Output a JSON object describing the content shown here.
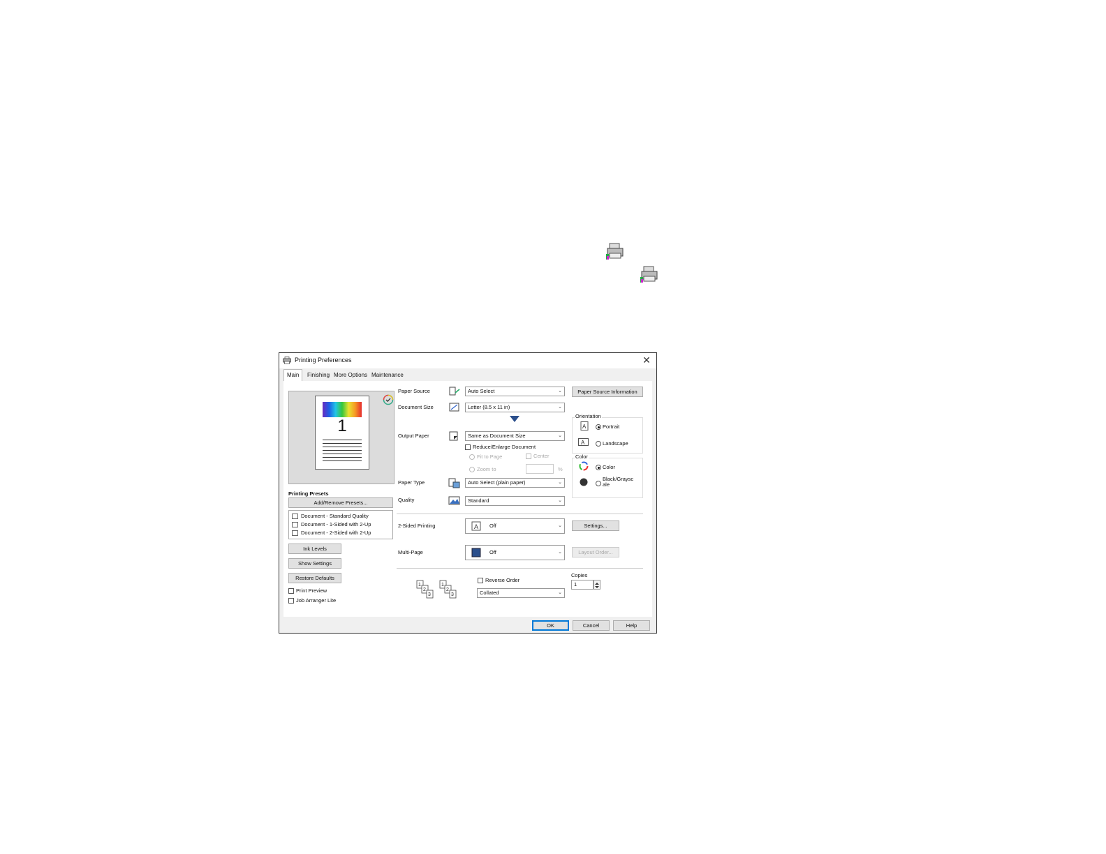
{
  "dialog": {
    "title": "Printing Preferences",
    "close_symbol": "✕",
    "tabs": [
      {
        "label": "Main",
        "active": true
      },
      {
        "label": "Finishing"
      },
      {
        "label": "More Options"
      },
      {
        "label": "Maintenance"
      }
    ],
    "preview": {
      "page_number": "1"
    },
    "presets": {
      "heading": "Printing Presets",
      "add_remove_button": "Add/Remove Presets...",
      "items": [
        "Document - Standard Quality",
        "Document - 1-Sided with 2-Up",
        "Document - 2-Sided with 2-Up"
      ]
    },
    "left_buttons": {
      "ink_levels": "Ink Levels",
      "show_settings": "Show Settings",
      "restore_defaults": "Restore Defaults"
    },
    "checkboxes": {
      "print_preview": "Print Preview",
      "job_arranger": "Job Arranger Lite"
    },
    "paper_source": {
      "label": "Paper Source",
      "value": "Auto Select",
      "info_button": "Paper Source Information"
    },
    "document_size": {
      "label": "Document Size",
      "value": "Letter (8.5 x 11 in)"
    },
    "output_paper": {
      "label": "Output Paper",
      "value": "Same as Document Size",
      "reduce_enlarge": "Reduce/Enlarge Document",
      "fit_to_page": "Fit to Page",
      "center": "Center",
      "zoom_to": "Zoom to",
      "percent": "%"
    },
    "orientation": {
      "label": "Orientation",
      "portrait": "Portrait",
      "landscape": "Landscape"
    },
    "color": {
      "label": "Color",
      "color_option": "Color",
      "bw_line1": "Black/Graysc",
      "bw_line2": "ale"
    },
    "paper_type": {
      "label": "Paper Type",
      "value": "Auto Select (plain paper)"
    },
    "quality": {
      "label": "Quality",
      "value": "Standard"
    },
    "two_sided": {
      "label": "2-Sided Printing",
      "value": "Off",
      "settings_button": "Settings..."
    },
    "multi_page": {
      "label": "Multi-Page",
      "value": "Off",
      "layout_button": "Layout Order..."
    },
    "copies": {
      "reverse_order": "Reverse Order",
      "collated": "Collated",
      "label": "Copies",
      "value": "1"
    },
    "footer": {
      "ok": "OK",
      "cancel": "Cancel",
      "help": "Help"
    },
    "chevron": "⌄",
    "icons": [
      "printer-icon",
      "check-circle-icon",
      "paper-source-icon",
      "document-size-icon",
      "output-paper-icon",
      "paper-type-icon",
      "quality-icon",
      "orientation-portrait-icon",
      "orientation-landscape-icon",
      "color-ring-icon",
      "black-circle-icon",
      "collate-icon"
    ]
  }
}
